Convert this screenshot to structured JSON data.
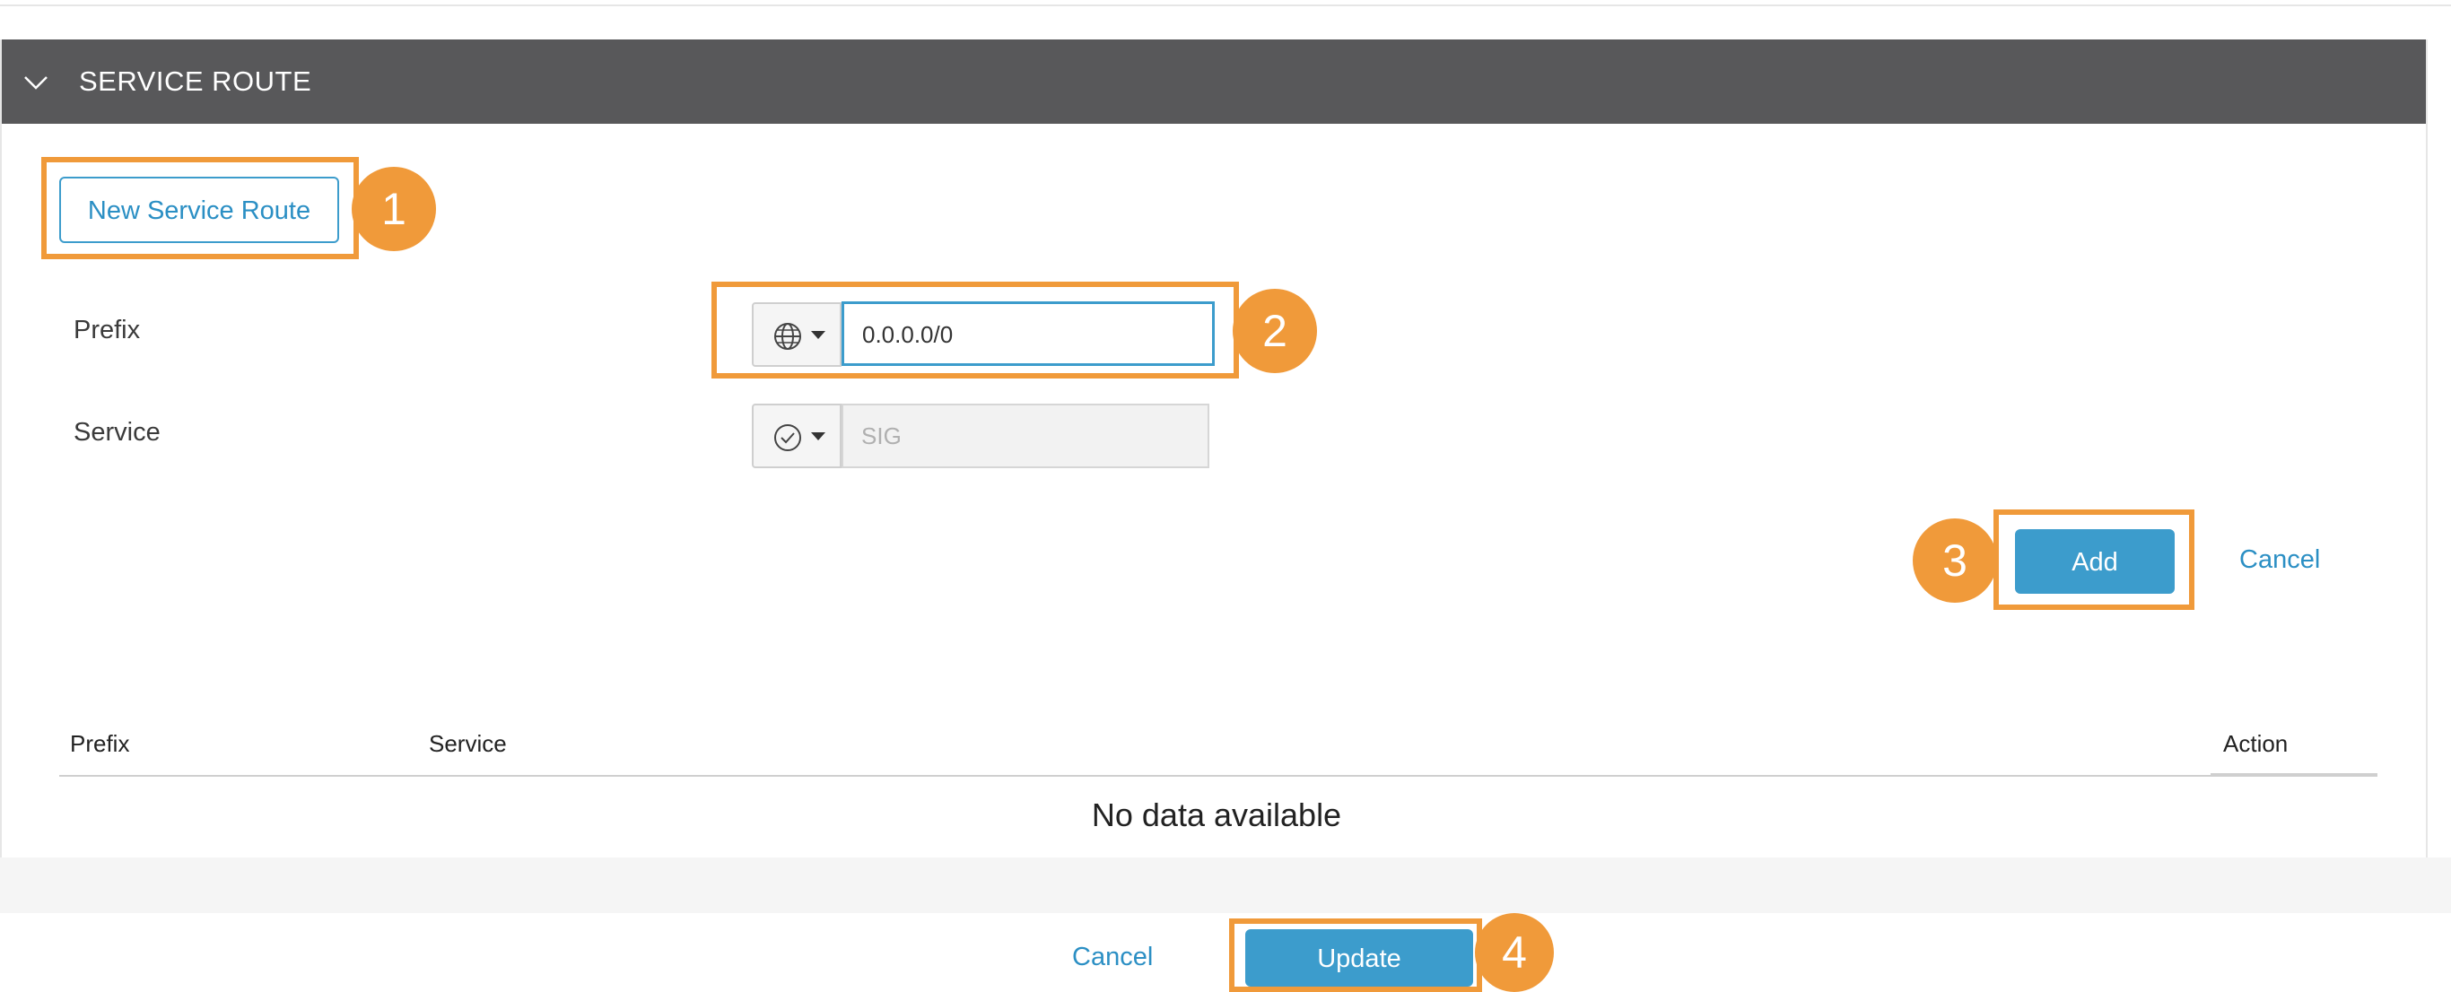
{
  "section": {
    "title": "SERVICE ROUTE"
  },
  "new_route_button": "New Service Route",
  "form": {
    "prefix_label": "Prefix",
    "prefix_value": "0.0.0.0/0",
    "prefix_icon": "globe-icon",
    "service_label": "Service",
    "service_value": "SIG",
    "service_icon": "check-circle-icon"
  },
  "form_actions": {
    "add_label": "Add",
    "cancel_label": "Cancel"
  },
  "table": {
    "columns": [
      "Prefix",
      "Service",
      "Action"
    ],
    "empty_message": "No data available"
  },
  "footer": {
    "cancel_label": "Cancel",
    "update_label": "Update"
  },
  "callouts": [
    "1",
    "2",
    "3",
    "4"
  ],
  "colors": {
    "header_bg": "#58585a",
    "accent_blue": "#3c9ccc",
    "callout_orange": "#f09a3a"
  }
}
